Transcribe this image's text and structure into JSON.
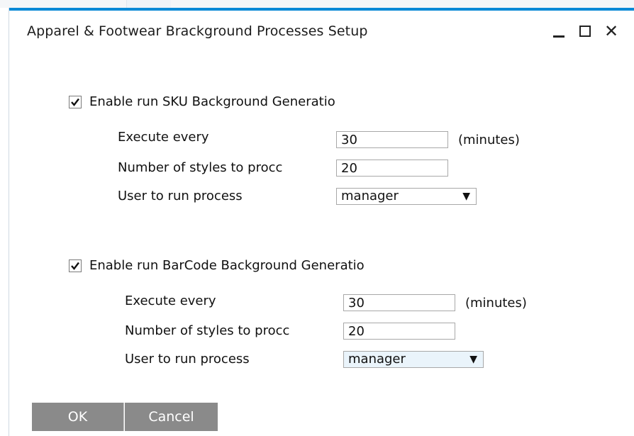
{
  "window": {
    "title": "Apparel & Footwear Brackground Processes Setup"
  },
  "sku_section": {
    "enable_label": "Enable run SKU Background Generatio",
    "enabled": true,
    "execute_label": "Execute every",
    "execute_value": "30",
    "execute_unit": "(minutes)",
    "styles_label": "Number of styles to procc",
    "styles_value": "20",
    "user_label": "User to run process",
    "user_value": "manager"
  },
  "barcode_section": {
    "enable_label": "Enable run BarCode Background Generatio",
    "enabled": true,
    "execute_label": "Execute every",
    "execute_value": "30",
    "execute_unit": "(minutes)",
    "styles_label": "Number of styles to procc",
    "styles_value": "20",
    "user_label": "User to run process",
    "user_value": "manager"
  },
  "buttons": {
    "ok_label": "OK",
    "cancel_label": "Cancel"
  },
  "icons": {
    "minimize": "minimize-icon",
    "maximize": "maximize-icon",
    "close": "close-icon",
    "checkmark": "checkmark-icon",
    "dropdown": "dropdown-arrow-icon"
  },
  "colors": {
    "accent": "#0a89d6",
    "button": "#8a8a8a"
  }
}
